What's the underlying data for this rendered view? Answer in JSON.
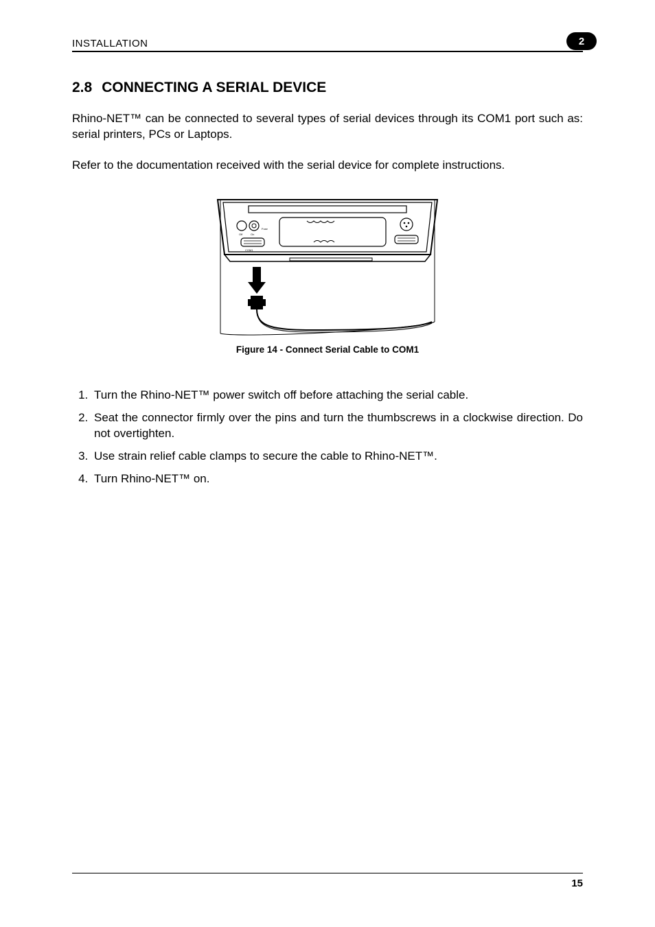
{
  "header": {
    "title": "INSTALLATION",
    "chapter": "2"
  },
  "section": {
    "number": "2.8",
    "title": "CONNECTING A SERIAL DEVICE"
  },
  "paragraphs": {
    "p1": "Rhino-NET™ can be connected to several types of serial devices through its COM1 port such as: serial printers, PCs or Laptops.",
    "p2": "Refer to the documentation received with the serial device for complete instructions."
  },
  "figure": {
    "caption": "Figure 14 - Connect Serial Cable to COM1"
  },
  "steps": [
    "Turn the Rhino-NET™ power switch off before attaching the serial cable.",
    "Seat the connector firmly over the pins and turn the thumbscrews in a clockwise direction. Do not overtighten.",
    "Use strain relief cable clamps to secure the cable to Rhino-NET™.",
    "Turn Rhino-NET™ on."
  ],
  "footer": {
    "page": "15"
  }
}
